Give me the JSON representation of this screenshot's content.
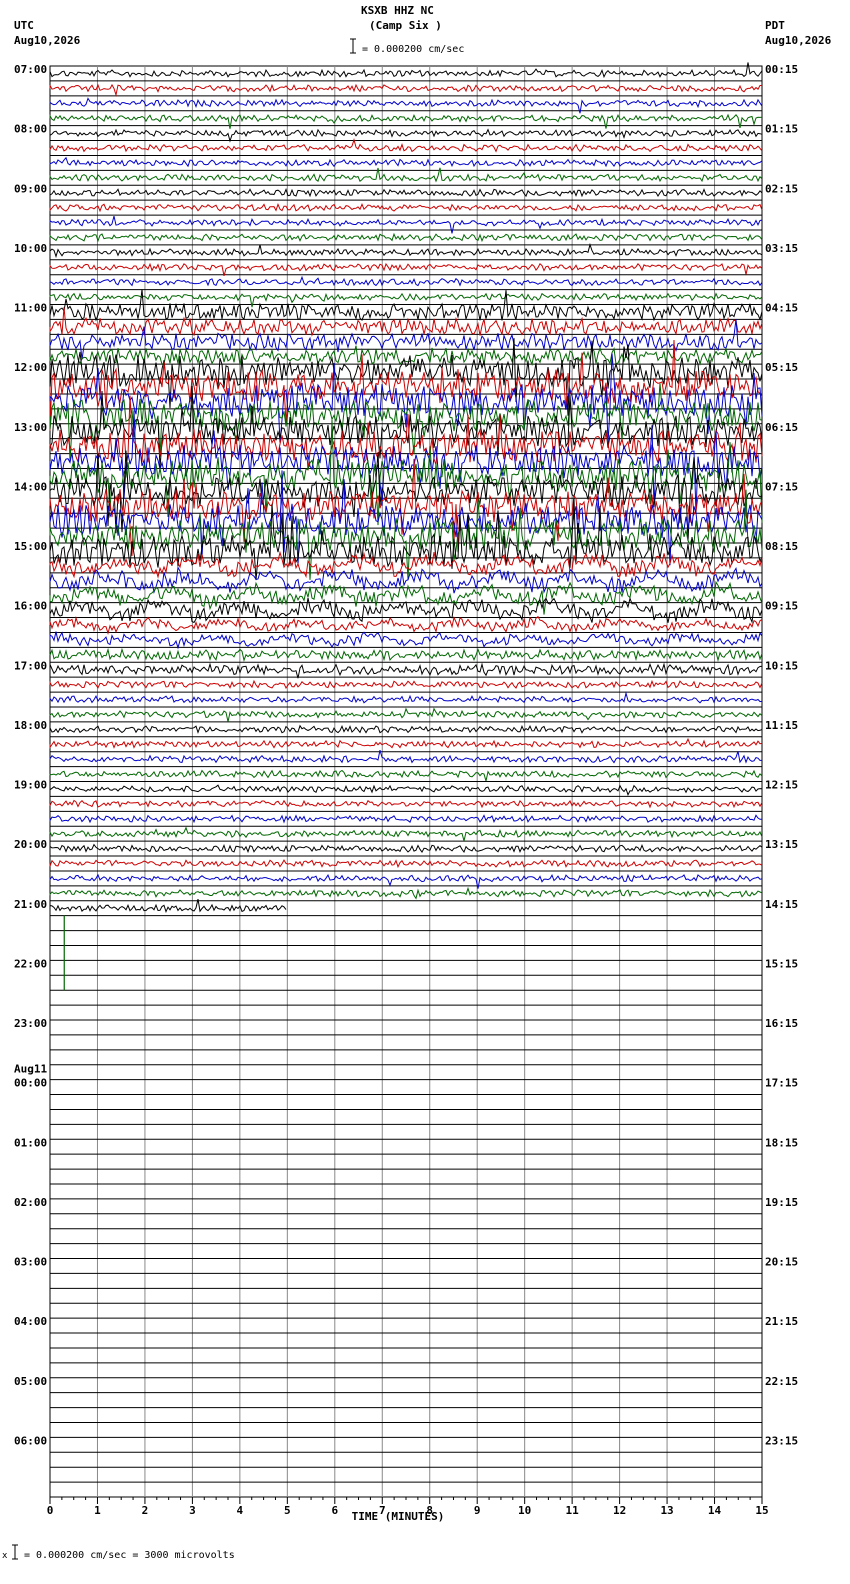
{
  "header": {
    "station": "KSXB HHZ NC",
    "site": "(Camp Six )",
    "left_tz": "UTC",
    "left_date": "Aug10,2026",
    "right_tz": "PDT",
    "right_date": "Aug10,2026",
    "scale_text": "= 0.000200 cm/sec"
  },
  "footer": {
    "scale_prefix": "x",
    "scale_text": "= 0.000200 cm/sec =    3000 microvolts"
  },
  "chart_data": {
    "type": "line",
    "description_type": "helicorder",
    "xlabel": "TIME (MINUTES)",
    "xlim": [
      0,
      15
    ],
    "x_ticks": [
      "0",
      "1",
      "2",
      "3",
      "4",
      "5",
      "6",
      "7",
      "8",
      "9",
      "10",
      "11",
      "12",
      "13",
      "14",
      "15"
    ],
    "rows_per_hour": 4,
    "total_rows": 96,
    "traced_rows": 57,
    "last_row_end_minute": 5,
    "trace_colors": [
      "#000000",
      "#cc0000",
      "#0000cc",
      "#006600"
    ],
    "left_labels": [
      "07:00",
      "08:00",
      "09:00",
      "10:00",
      "11:00",
      "12:00",
      "13:00",
      "14:00",
      "15:00",
      "16:00",
      "17:00",
      "18:00",
      "19:00",
      "20:00",
      "21:00",
      "22:00",
      "23:00",
      "00:00",
      "01:00",
      "02:00",
      "03:00",
      "04:00",
      "05:00",
      "06:00"
    ],
    "left_date_change": {
      "index": 17,
      "label": "Aug11"
    },
    "right_labels": [
      "00:15",
      "01:15",
      "02:15",
      "03:15",
      "04:15",
      "05:15",
      "06:15",
      "07:15",
      "08:15",
      "09:15",
      "10:15",
      "11:15",
      "12:15",
      "13:15",
      "14:15",
      "15:15",
      "16:15",
      "17:15",
      "18:15",
      "19:15",
      "20:15",
      "21:15",
      "22:15",
      "23:15"
    ]
  }
}
